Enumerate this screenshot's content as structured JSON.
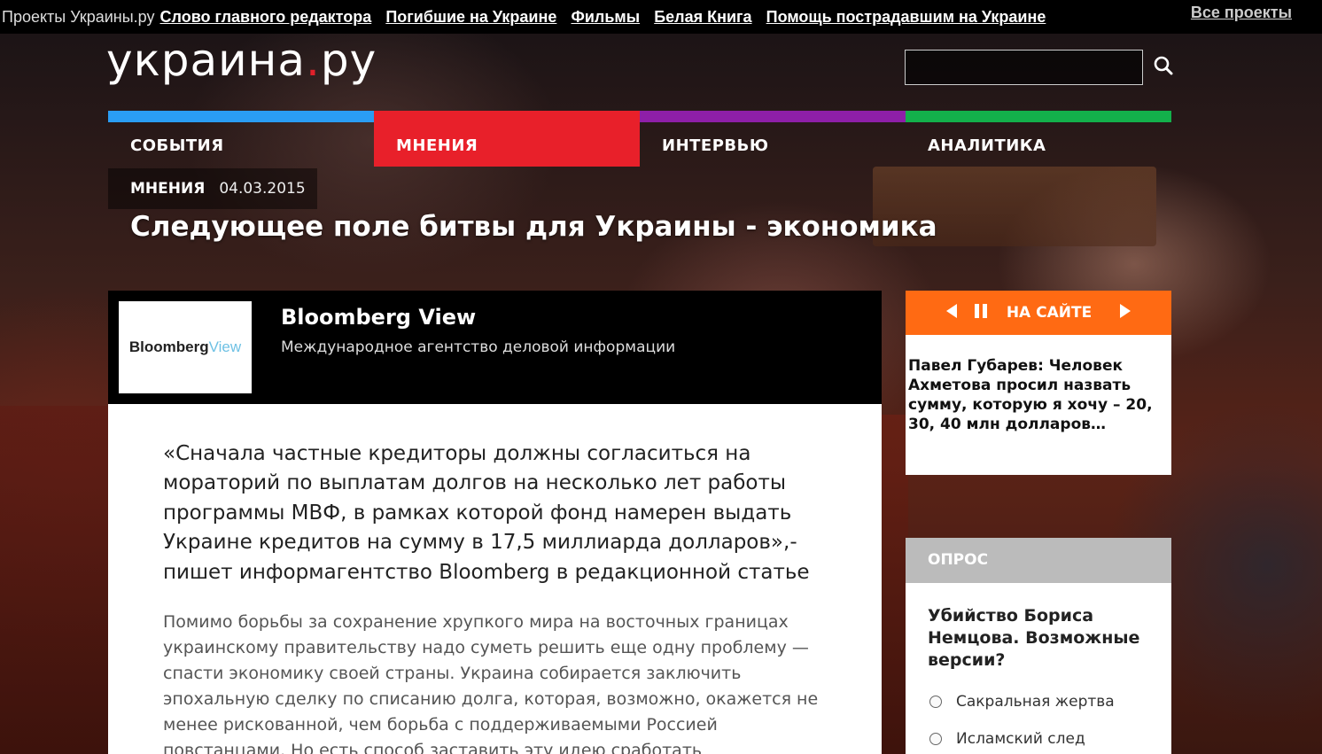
{
  "topbar": {
    "brand": "Проекты Украины.ру",
    "links": [
      "Слово главного редактора",
      "Погибшие на Украине",
      "Фильмы",
      "Белая Книга",
      "Помощь пострадавшим на Украине"
    ],
    "all_projects": "Все проекты"
  },
  "logo": {
    "main": "украина",
    "dot": ".",
    "suffix": "ру"
  },
  "search": {
    "placeholder": "",
    "icon": "search-icon"
  },
  "nav": {
    "items": [
      {
        "label": "СОБЫТИЯ",
        "color": "#2a9df4"
      },
      {
        "label": "МНЕНИЯ",
        "color": "#e8202a"
      },
      {
        "label": "ИНТЕРВЬЮ",
        "color": "#8e1fa8"
      },
      {
        "label": "АНАЛИТИКА",
        "color": "#13b04b"
      }
    ],
    "active": 1
  },
  "article": {
    "category": "МНЕНИЯ",
    "date": "04.03.2015",
    "headline": "Следующее поле битвы для Украины - экономика",
    "source": {
      "logo_text": "Bloomberg",
      "logo_text_accent": "View",
      "name": "Bloomberg View",
      "description": "Международное агентство деловой информации"
    },
    "lead": "«Сначала частные кредиторы должны согласиться на мораторий по выплатам долгов на несколько лет работы программы МВФ, в рамках которой фонд намерен выдать Украине кредитов на сумму в 17,5 миллиарда долларов»,- пишет информагентство Bloomberg в редакционной статье",
    "body": "Помимо борьбы за сохранение хрупкого мира на восточных границах украинскому правительству надо суметь решить еще одну проблему — спасти экономику своей страны. Украина собирается заключить эпохальную сделку по списанию долга, которая, возможно, окажется не менее рискованной, чем борьба с поддерживаемыми Россией повстанцами. Но есть способ заставить эту идею сработать"
  },
  "onsite": {
    "title": "НА САЙТЕ",
    "prev_icon": "prev-arrow-icon",
    "pause_icon": "pause-icon",
    "next_icon": "next-arrow-icon",
    "news": "Павел Губарев: Человек Ахметова просил назвать сумму, которую я хочу – 20, 30, 40 млн долларов…",
    "accent": "#ff6a13"
  },
  "poll": {
    "title": "ОПРОС",
    "question": "Убийство Бориса Немцова. Возможные версии?",
    "options": [
      "Сакральная жертва",
      "Исламский след"
    ]
  }
}
